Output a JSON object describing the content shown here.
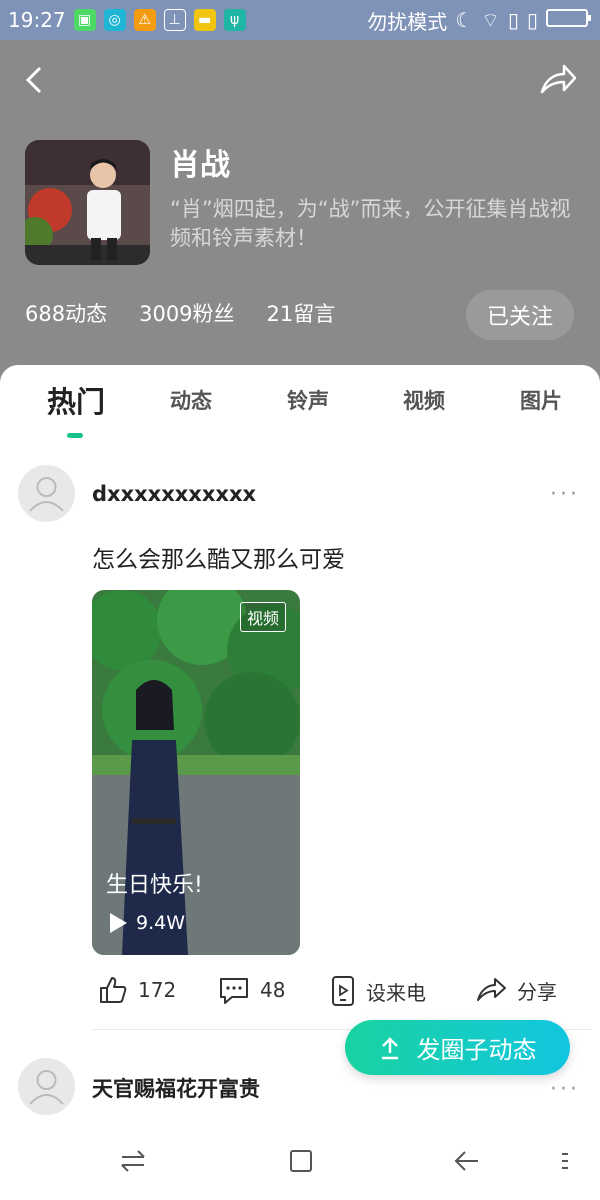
{
  "status_bar": {
    "time": "19:27",
    "dnd_label": "勿扰模式",
    "app_icons": [
      "green-app-icon",
      "blue-app-icon",
      "warning-icon",
      "broom-icon",
      "folder-icon",
      "usb-icon"
    ]
  },
  "header": {
    "name": "肖战",
    "description": "“肖”烟四起，为“战”而来，公开征集肖战视频和铃声素材！",
    "stats": {
      "posts": "688动态",
      "fans": "3009粉丝",
      "comments": "21留言"
    },
    "follow_label": "已关注"
  },
  "tabs": [
    {
      "label": "热门",
      "active": true
    },
    {
      "label": "动态",
      "active": false
    },
    {
      "label": "铃声",
      "active": false
    },
    {
      "label": "视频",
      "active": false
    },
    {
      "label": "图片",
      "active": false
    }
  ],
  "post1": {
    "username": "dxxxxxxxxxxx",
    "text": "怎么会那么酷又那么可爱",
    "video": {
      "badge": "视频",
      "caption": "生日快乐!",
      "plays": "9.4W"
    },
    "actions": {
      "likes": "172",
      "comments": "48",
      "ringtone": "设来电",
      "share": "分享"
    }
  },
  "post2": {
    "username": "天官赐福花开富贵"
  },
  "fab_label": "发圈子动态",
  "colors": {
    "accent": "#15c28b",
    "header_bg": "#8a8a8a",
    "status_bg": "#7f93b8"
  }
}
